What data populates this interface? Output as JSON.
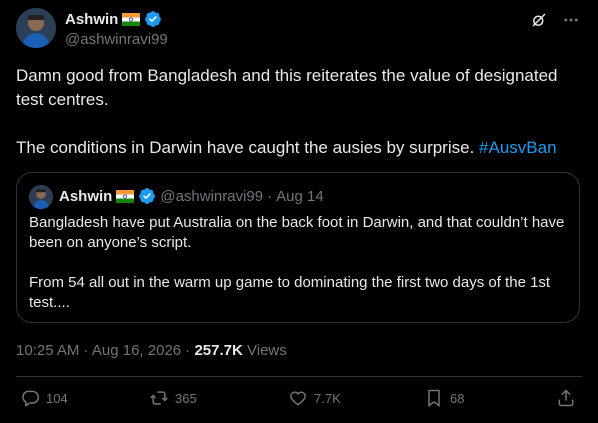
{
  "tweet": {
    "author": {
      "name": "Ashwin",
      "handle": "@ashwinravi99",
      "flag_icon": "india-flag-icon",
      "verified_icon": "verified-badge-icon"
    },
    "paragraphs": [
      "Damn good from Bangladesh and this reiterates the value of designated test centres."
    ],
    "line2_text": "The conditions in Darwin have caught the ausies by surprise.",
    "hashtag": "#AusvBan",
    "timestamp": "10:25 AM · Aug 16, 2026",
    "separator": " · ",
    "views_count": "257.7K",
    "views_label": "Views"
  },
  "quote": {
    "author": {
      "name": "Ashwin",
      "handle": "@ashwinravi99",
      "date": "Aug 14",
      "separator": " · "
    },
    "paragraphs": [
      "Bangladesh have put Australia on the back foot in Darwin, and that couldn’t have been on anyone’s script.",
      "From 54 all out in the warm up game to dominating the first two days of the 1st test...."
    ]
  },
  "actions": {
    "replies": "104",
    "reposts": "365",
    "likes": "7.7K",
    "bookmarks": "68"
  },
  "colors": {
    "background": "#000000",
    "text": "#e7e9ea",
    "secondary": "#71767b",
    "accent": "#1d9bf0",
    "border": "#2f3336"
  },
  "icons": [
    "grok-icon",
    "more-icon",
    "reply-icon",
    "repost-icon",
    "like-icon",
    "bookmark-icon",
    "share-icon"
  ]
}
